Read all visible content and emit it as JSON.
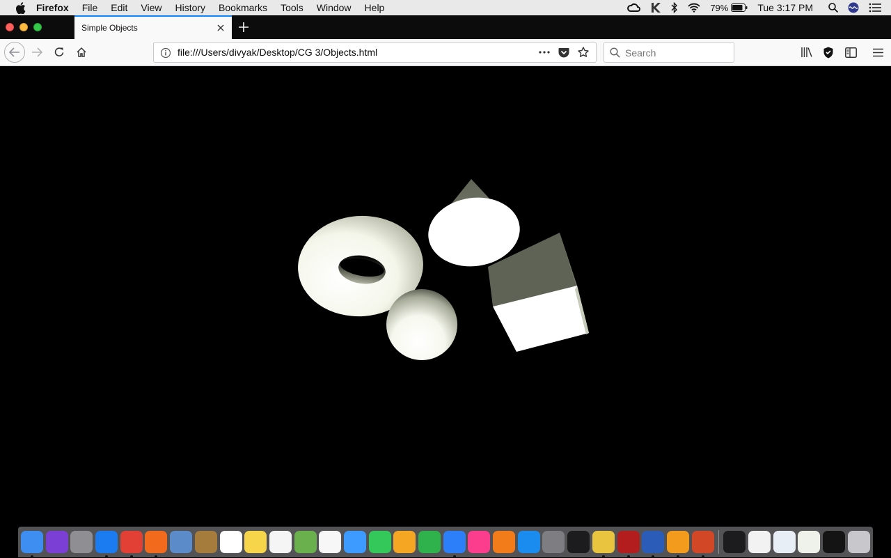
{
  "menubar": {
    "app_name": "Firefox",
    "items": [
      "File",
      "Edit",
      "View",
      "History",
      "Bookmarks",
      "Tools",
      "Window",
      "Help"
    ],
    "battery_percent": "79%",
    "clock": "Tue 3:17 PM"
  },
  "tab": {
    "title": "Simple Objects"
  },
  "navbar": {
    "url": "file:///Users/divyak/Desktop/CG 3/Objects.html",
    "search_placeholder": "Search"
  },
  "scene": {
    "objects": [
      "torus",
      "cone",
      "cube",
      "sphere"
    ],
    "background_color": "#000000",
    "light_color": "#ffffff",
    "shadow_color": "#5f6356"
  },
  "dock": {
    "apps": [
      {
        "icon": "finder-icon",
        "color": "#3d8ef0",
        "running": true
      },
      {
        "icon": "siri-icon",
        "color": "#7b3fd6",
        "running": false
      },
      {
        "icon": "launchpad-icon",
        "color": "#8e8e93",
        "running": false
      },
      {
        "icon": "safari-icon",
        "color": "#1b7cf2",
        "running": true
      },
      {
        "icon": "chrome-icon",
        "color": "#e24034",
        "running": true
      },
      {
        "icon": "firefox-icon",
        "color": "#f26b1d",
        "running": true
      },
      {
        "icon": "preview-icon",
        "color": "#5b8cc9",
        "running": false
      },
      {
        "icon": "notebook-icon",
        "color": "#a67c3c",
        "running": false
      },
      {
        "icon": "calendar-icon",
        "color": "#ffffff",
        "running": false
      },
      {
        "icon": "notes-icon",
        "color": "#f7d54a",
        "running": false
      },
      {
        "icon": "reminders-icon",
        "color": "#f5f5f5",
        "running": false
      },
      {
        "icon": "maps-icon",
        "color": "#6ab04c",
        "running": false
      },
      {
        "icon": "photos-icon",
        "color": "#f7f7f7",
        "running": false
      },
      {
        "icon": "messages-icon",
        "color": "#3d9bff",
        "running": false
      },
      {
        "icon": "facetime-icon",
        "color": "#34c759",
        "running": false
      },
      {
        "icon": "pages-icon",
        "color": "#f5a623",
        "running": false
      },
      {
        "icon": "numbers-icon",
        "color": "#2fb24c",
        "running": false
      },
      {
        "icon": "keynote-icon",
        "color": "#2d7ff9",
        "running": true
      },
      {
        "icon": "itunes-icon",
        "color": "#fc3c8d",
        "running": false
      },
      {
        "icon": "books-icon",
        "color": "#f27b1a",
        "running": false
      },
      {
        "icon": "app-store-icon",
        "color": "#1a8cf0",
        "running": false
      },
      {
        "icon": "system-preferences-icon",
        "color": "#7d7d82",
        "running": false
      },
      {
        "icon": "terminal-icon",
        "color": "#1c1c1e",
        "running": false
      },
      {
        "icon": "cyberduck-icon",
        "color": "#e9c53f",
        "running": true
      },
      {
        "icon": "acrobat-icon",
        "color": "#b41d1d",
        "running": true
      },
      {
        "icon": "word-icon",
        "color": "#2b5cb8",
        "running": true
      },
      {
        "icon": "sublime-icon",
        "color": "#f29b1d",
        "running": true
      },
      {
        "icon": "powerpoint-icon",
        "color": "#d24726",
        "running": true
      }
    ],
    "docs": [
      {
        "icon": "html-file-icon",
        "color": "#1c1c1e"
      },
      {
        "icon": "document-thumbnail-icon",
        "color": "#f2f2f2"
      },
      {
        "icon": "document-thumbnail-icon",
        "color": "#e8eef5"
      },
      {
        "icon": "document-thumbnail-icon",
        "color": "#eef2ea"
      },
      {
        "icon": "document-thumbnail-icon",
        "color": "#141414"
      },
      {
        "icon": "trash-icon",
        "color": "#c8c8cc"
      }
    ]
  }
}
